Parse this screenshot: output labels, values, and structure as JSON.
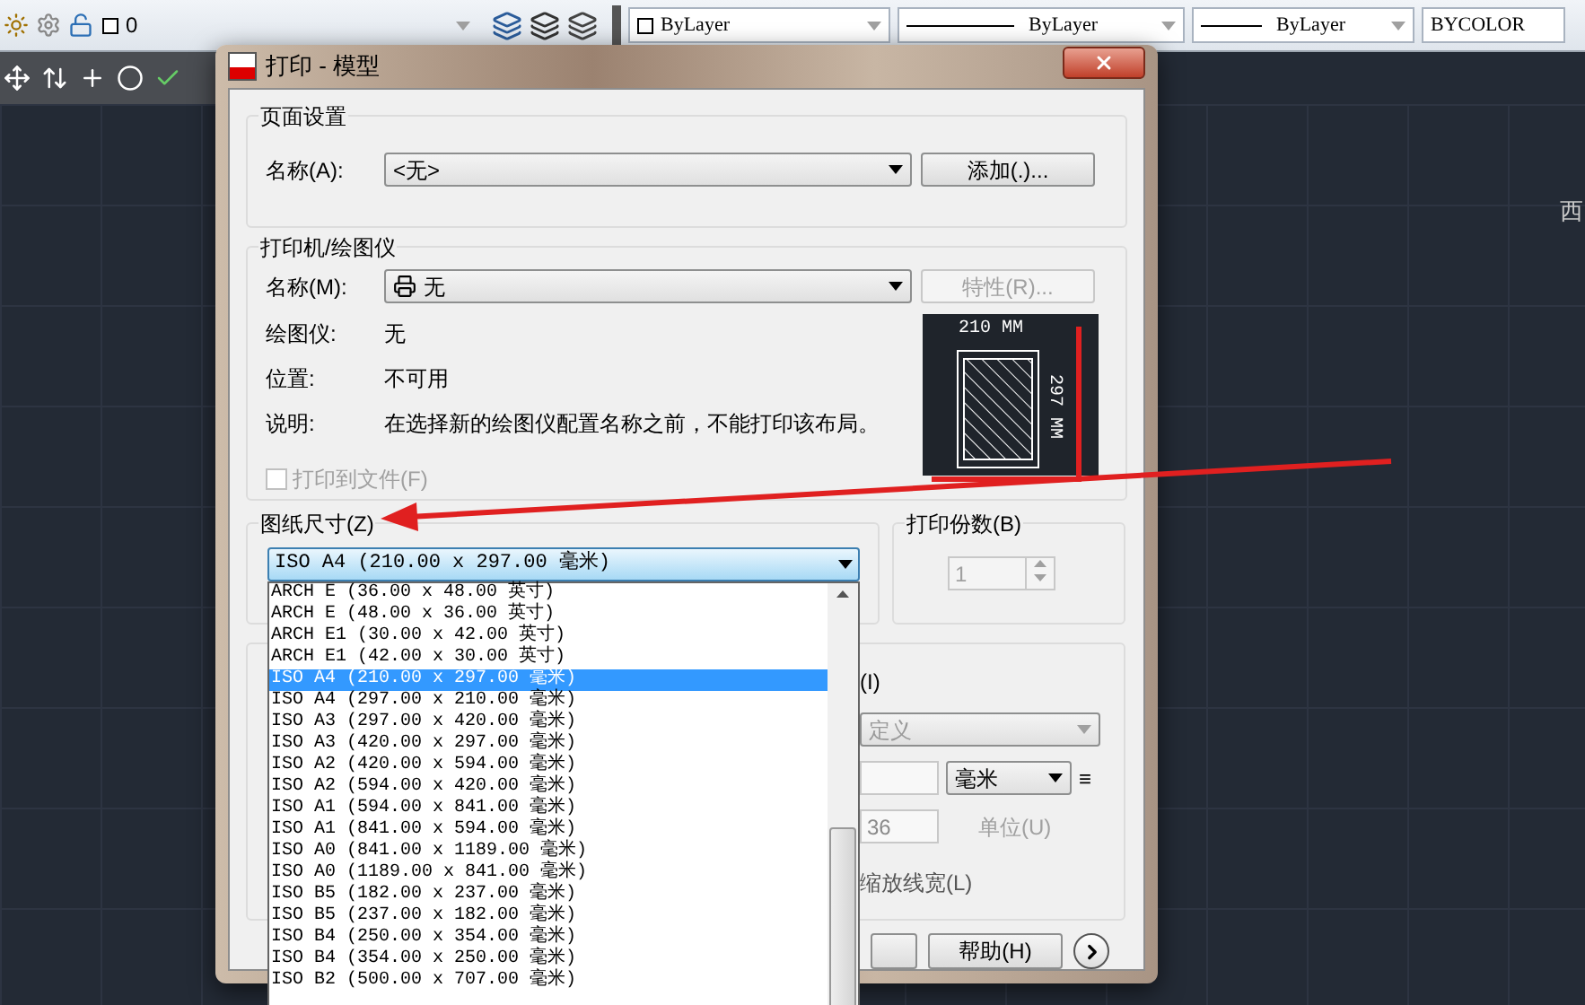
{
  "toolbar": {
    "layer_value": "0",
    "color_setting": "ByLayer",
    "linetype": "ByLayer",
    "lineweight": "ByLayer",
    "plot_style": "BYCOLOR"
  },
  "viewcube_label": "西",
  "dialog": {
    "title": "打印 - 模型",
    "page_setup": {
      "title": "页面设置",
      "name_label": "名称(A):",
      "name_value": "<无>",
      "add_button": "添加(.)..."
    },
    "printer": {
      "title": "打印机/绘图仪",
      "name_label": "名称(M):",
      "name_value": "无",
      "properties_button": {
        "label": "特性(R)...",
        "disabled": true
      },
      "info": [
        {
          "label": "绘图仪:",
          "value": "无"
        },
        {
          "label": "位置:",
          "value": "不可用"
        },
        {
          "label": "说明:",
          "value": "在选择新的绘图仪配置名称之前，不能打印该布局。"
        }
      ],
      "print_to_file": {
        "label": "打印到文件(F)",
        "checked": false,
        "disabled": true
      },
      "preview": {
        "width": "210 MM",
        "height": "297 MM"
      }
    },
    "paper_size": {
      "title": "图纸尺寸(Z)",
      "value": "ISO A4 (210.00 x 297.00 毫米)",
      "expanded": true,
      "options": [
        {
          "label": "ARCH E (36.00 x 48.00 英寸)",
          "selected": false
        },
        {
          "label": "ARCH E (48.00 x 36.00 英寸)",
          "selected": false
        },
        {
          "label": "ARCH E1 (30.00 x 42.00 英寸)",
          "selected": false
        },
        {
          "label": "ARCH E1 (42.00 x 30.00 英寸)",
          "selected": false
        },
        {
          "label": "ISO A4 (210.00 x 297.00 毫米)",
          "selected": true
        },
        {
          "label": "ISO A4 (297.00 x 210.00 毫米)",
          "selected": false
        },
        {
          "label": "ISO A3 (297.00 x 420.00 毫米)",
          "selected": false
        },
        {
          "label": "ISO A3 (420.00 x 297.00 毫米)",
          "selected": false
        },
        {
          "label": "ISO A2 (420.00 x 594.00 毫米)",
          "selected": false
        },
        {
          "label": "ISO A2 (594.00 x 420.00 毫米)",
          "selected": false
        },
        {
          "label": "ISO A1 (594.00 x 841.00 毫米)",
          "selected": false
        },
        {
          "label": "ISO A1 (841.00 x 594.00 毫米)",
          "selected": false
        },
        {
          "label": "ISO A0 (841.00 x 1189.00 毫米)",
          "selected": false
        },
        {
          "label": "ISO A0 (1189.00 x 841.00 毫米)",
          "selected": false
        },
        {
          "label": "ISO B5 (182.00 x 237.00 毫米)",
          "selected": false
        },
        {
          "label": "ISO B5 (237.00 x 182.00 毫米)",
          "selected": false
        },
        {
          "label": "ISO B4 (250.00 x 354.00 毫米)",
          "selected": false
        },
        {
          "label": "ISO B4 (354.00 x 250.00 毫米)",
          "selected": false
        },
        {
          "label": "ISO B2 (500.00 x 707.00 毫米)",
          "selected": false
        }
      ]
    },
    "copies": {
      "title": "打印份数(B)",
      "value": "1",
      "disabled": true
    },
    "scale": {
      "suffix": "(I)",
      "value": "定义",
      "units": "毫米",
      "equals": "≡",
      "unit_count": "36",
      "unit_label": "单位(U)",
      "scale_lineweights": "缩放线宽(L)"
    },
    "help_button": "帮助(H)"
  }
}
